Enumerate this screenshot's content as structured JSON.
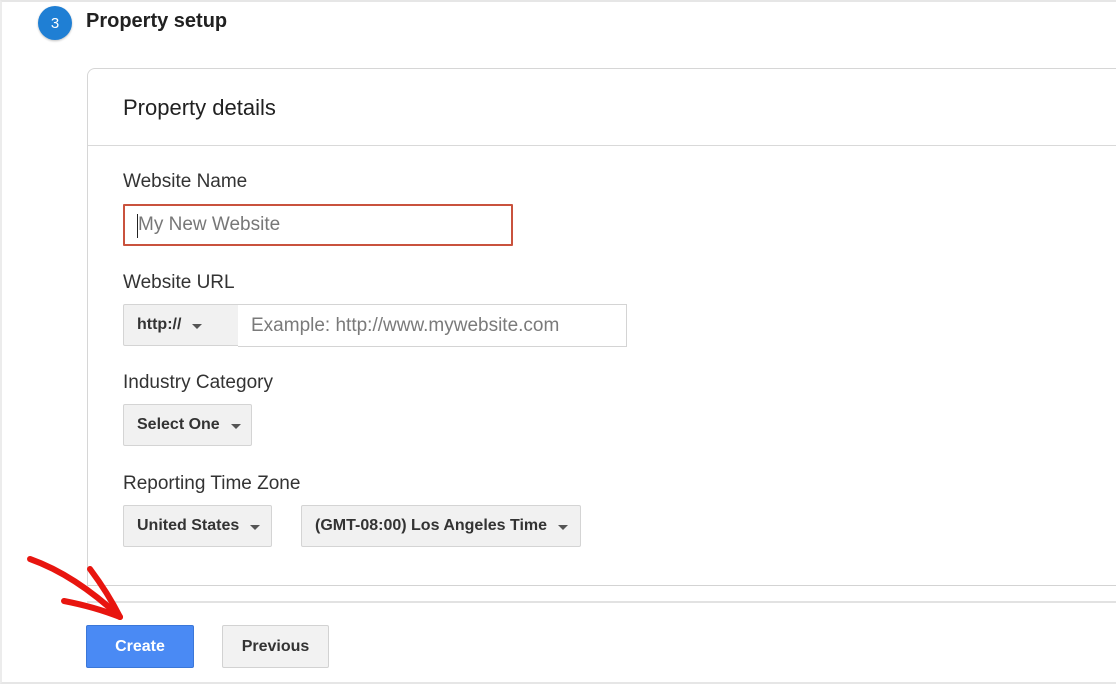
{
  "step": {
    "number": "3",
    "title": "Property setup"
  },
  "card": {
    "title": "Property details"
  },
  "fields": {
    "website_name": {
      "label": "Website Name",
      "placeholder": "My New Website",
      "value": ""
    },
    "website_url": {
      "label": "Website URL",
      "protocol_selected": "http://",
      "placeholder": "Example: http://www.mywebsite.com",
      "value": ""
    },
    "industry_category": {
      "label": "Industry Category",
      "selected": "Select One"
    },
    "reporting_time_zone": {
      "label": "Reporting Time Zone",
      "country_selected": "United States",
      "zone_selected": "(GMT-08:00) Los Angeles Time"
    }
  },
  "buttons": {
    "create": "Create",
    "previous": "Previous"
  },
  "annotation": {
    "arrow_color": "#e8150f",
    "points_to": "create-button"
  },
  "colors": {
    "primary_button": "#4a8af4",
    "step_badge": "#1f7fd4",
    "error_border": "#c9523d"
  }
}
